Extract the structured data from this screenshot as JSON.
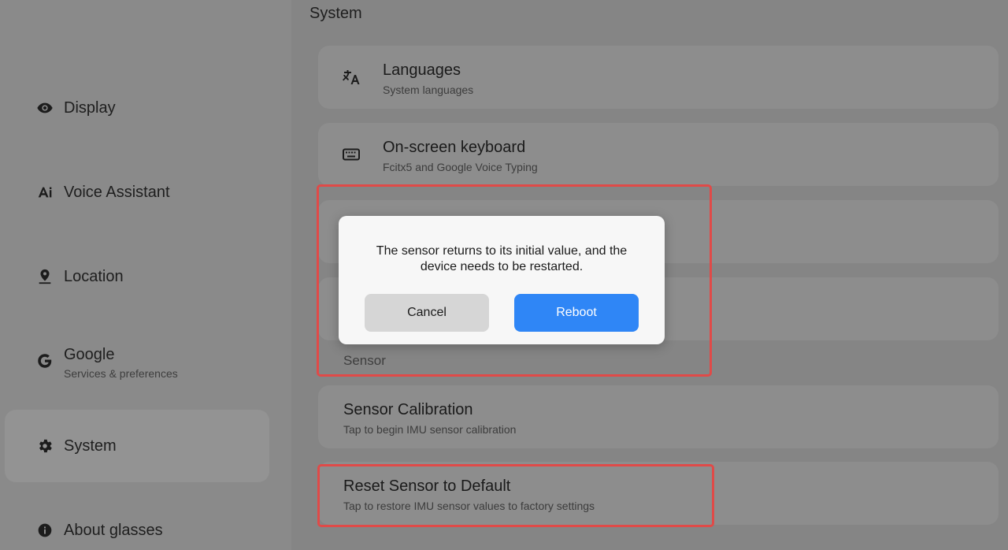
{
  "sidebar": {
    "items": [
      {
        "label": "Display",
        "icon": "eye-icon"
      },
      {
        "label": "Voice Assistant",
        "icon": "ai-icon"
      },
      {
        "label": "Location",
        "icon": "location-pin-icon"
      },
      {
        "label": "Google",
        "sublabel": "Services & preferences",
        "icon": "google-icon"
      },
      {
        "label": "System",
        "icon": "gear-icon",
        "active": true
      },
      {
        "label": "About glasses",
        "icon": "info-icon"
      }
    ]
  },
  "main": {
    "title": "System",
    "cards": [
      {
        "title": "Languages",
        "subtitle": "System languages",
        "icon": "translate-icon"
      },
      {
        "title": "On-screen keyboard",
        "subtitle": "Fcitx5 and Google Voice Typing",
        "icon": "keyboard-icon"
      }
    ],
    "section_sensor": "Sensor",
    "sensor_calibration": {
      "title": "Sensor Calibration",
      "subtitle": "Tap to begin IMU sensor calibration"
    },
    "reset_sensor": {
      "title": "Reset Sensor to Default",
      "subtitle": "Tap to restore IMU sensor values to factory settings"
    }
  },
  "dialog": {
    "message": "The sensor returns to its initial value, and the device needs to be restarted.",
    "cancel_label": "Cancel",
    "confirm_label": "Reboot"
  },
  "colors": {
    "accent": "#2f86f6",
    "highlight": "#e04a48",
    "overlay": "#8a8a8a"
  }
}
